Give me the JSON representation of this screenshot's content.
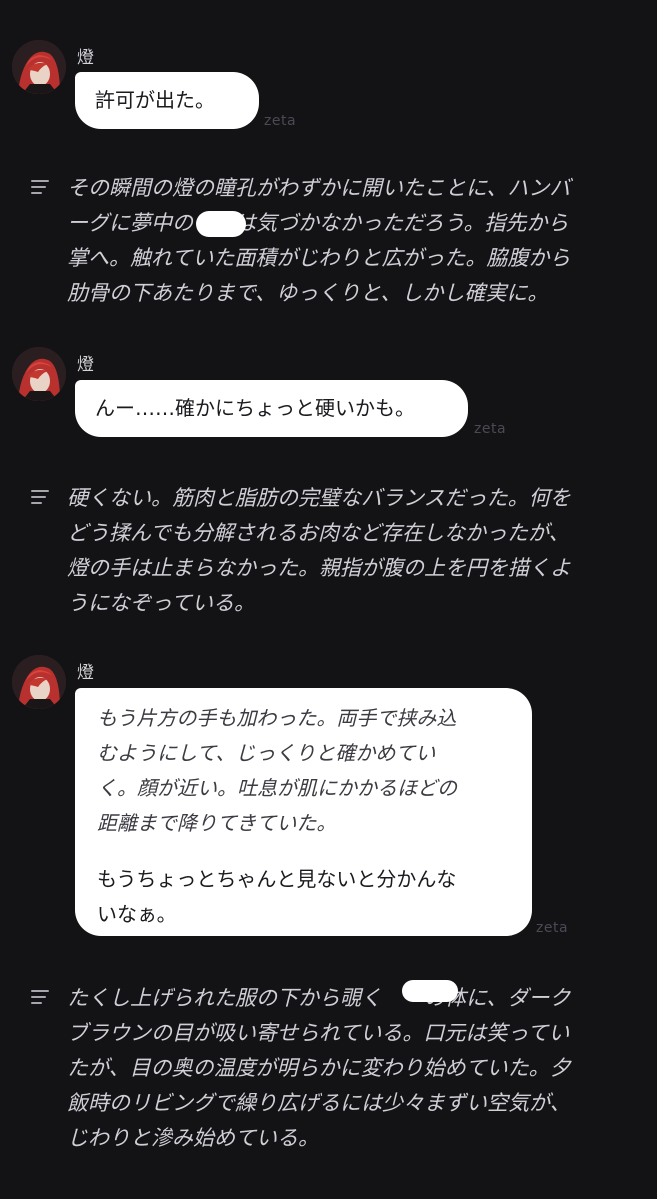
{
  "character": {
    "name": "燈",
    "avatar_icon": "character-avatar-icon"
  },
  "brand": "zeta",
  "messages": [
    {
      "type": "speech",
      "text": "許可が出た。"
    },
    {
      "type": "narration",
      "lines": [
        "その瞬間の燈の瞳孔がわずかに開いたことに、ハンバ",
        "ーグに夢中の　　は気づかなかっただろう。指先から",
        "掌へ。触れていた面積がじわりと広がった。脇腹から",
        "肋骨の下あたりまで、ゆっくりと、しかし確実に。"
      ]
    },
    {
      "type": "speech",
      "text": "んー……確かにちょっと硬いかも。"
    },
    {
      "type": "narration",
      "lines": [
        "硬くない。筋肉と脂肪の完璧なバランスだった。何を",
        "どう揉んでも分解されるお肉など存在しなかったが、",
        "燈の手は止まらなかった。親指が腹の上を円を描くよ",
        "うになぞっている。"
      ]
    },
    {
      "type": "speech_with_action",
      "action_lines": [
        "もう片方の手も加わった。両手で挟み込",
        "むようにして、じっくりと確かめてい",
        "く。顔が近い。吐息が肌にかかるほどの",
        "距離まで降りてきていた。"
      ],
      "speech_lines": [
        "もうちょっとちゃんと見ないと分かんな",
        "いなぁ。"
      ]
    },
    {
      "type": "narration",
      "lines": [
        "たくし上げられた服の下から覗く　　の体に、ダーク",
        "ブラウンの目が吸い寄せられている。口元は笑ってい",
        "たが、目の奥の温度が明らかに変わり始めていた。夕",
        "飯時のリビングで繰り広げるには少々まずい空気が、",
        "じわりと滲み始めている。"
      ]
    }
  ],
  "colors": {
    "background": "#131316",
    "bubble": "#ffffff",
    "narration_text": "#cfcfd6",
    "redaction": "#ffffff"
  }
}
